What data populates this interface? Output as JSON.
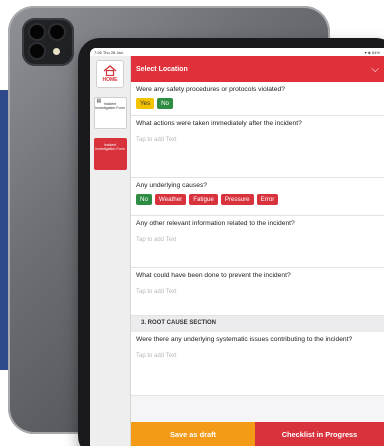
{
  "status_bar": {
    "time": "7:26 Thu 28 Jan",
    "battery": "▾ ◈ 64%"
  },
  "sidebar": {
    "home_label": "HOME",
    "forms": [
      {
        "label": "Incident Investigation Form"
      },
      {
        "label": "Incident Investigation Form"
      }
    ]
  },
  "header": {
    "title": "Select Location"
  },
  "questions": {
    "q1": {
      "text": "Were any safety procedures or protocols violated?",
      "options": [
        "Yes",
        "No"
      ]
    },
    "q2": {
      "text": "What actions were taken immediately after the incident?",
      "placeholder": "Tap to add Text"
    },
    "q3": {
      "text": "Any underlying causes?",
      "options": [
        "No",
        "Weather",
        "Fatigue",
        "Pressure",
        "Error"
      ]
    },
    "q4": {
      "text": "Any other relevant information related to the incident?",
      "placeholder": "Tap to add Text"
    },
    "q5": {
      "text": "What could have been done to prevent the incident?",
      "placeholder": "Tap to add Text"
    },
    "section3": {
      "title": "3. ROOT CAUSE SECTION"
    },
    "q6": {
      "text": "Were there any underlying systematic issues contributing to the incident?",
      "placeholder": "Tap to add Text"
    }
  },
  "footer": {
    "save_draft": "Save as draft",
    "checklist_status": "Checklist in Progress"
  },
  "colors": {
    "brand_red": "#e0313b",
    "draft_orange": "#f39a17",
    "green": "#2e8c43",
    "yellow": "#f3c300",
    "background_navy": "#2f4a8a"
  }
}
